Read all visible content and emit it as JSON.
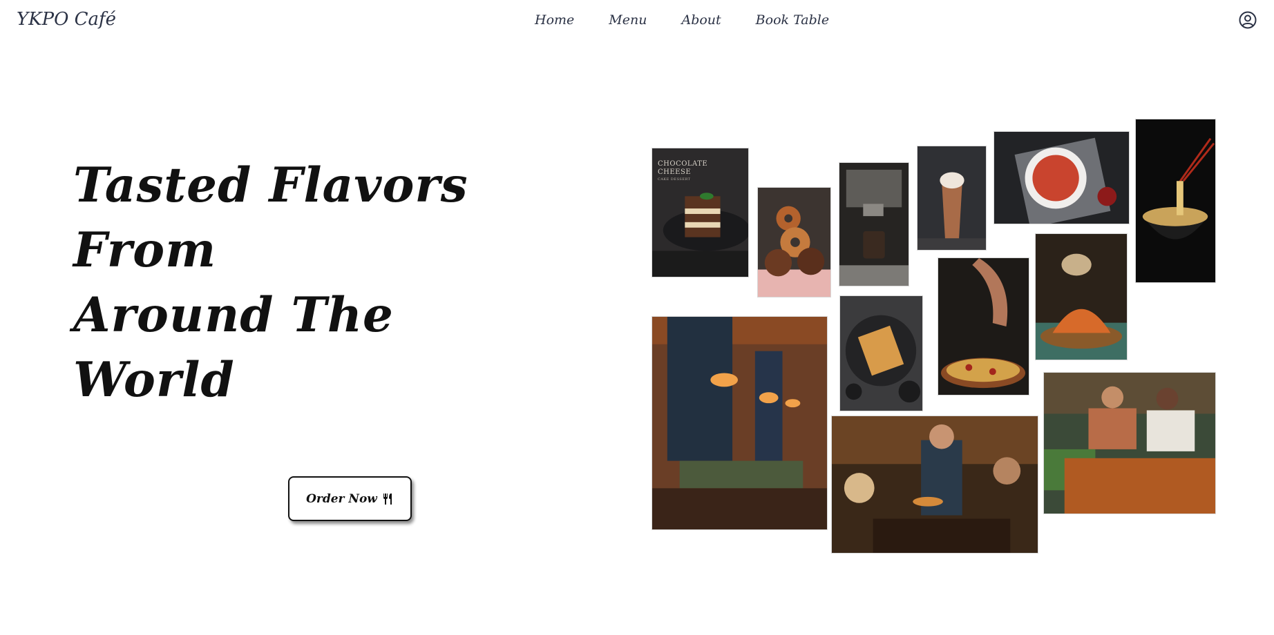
{
  "brand": {
    "name": "YKPO Café"
  },
  "nav": {
    "items": [
      {
        "label": "Home"
      },
      {
        "label": "Menu"
      },
      {
        "label": "About"
      },
      {
        "label": "Book Table"
      }
    ]
  },
  "account": {
    "icon": "user-circle-icon"
  },
  "hero": {
    "title_line_1": "Tasted Flavors From",
    "title_line_2": "Around The World",
    "cta_label": "Order Now",
    "cta_icon": "fork-knife-icon"
  },
  "gallery": {
    "chocolate_caption": "CHOCOLATE",
    "chocolate_caption_2": "CHEESE",
    "chocolate_caption_small": "CAKE DESSERT",
    "images": [
      "chocolate-cheesecake-image",
      "donuts-image",
      "espresso-machine-image",
      "iced-coffee-image",
      "pasta-bowl-image",
      "noodle-soup-image",
      "pizza-image",
      "spiced-dish-image",
      "restaurant-interior-image",
      "baklava-plate-image",
      "waiter-serving-image",
      "friends-dining-image"
    ]
  },
  "colors": {
    "nav_text": "#2b3245",
    "title_text": "#111111",
    "button_border": "#111111",
    "background": "#ffffff"
  }
}
